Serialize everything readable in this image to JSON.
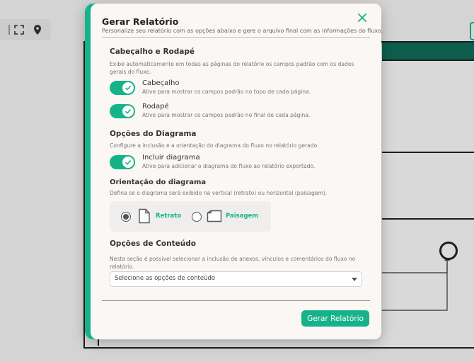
{
  "modal": {
    "title": "Gerar Relatório",
    "subtitle": "Personalize seu relatório com as opções abaixo e gere o arquivo final com as informações do fluxo."
  },
  "header_footer": {
    "title": "Cabeçalho e Rodapé",
    "description": "Exibe automaticamente em todas as páginas do relatório os campos padrão com os dados gerais do fluxo.",
    "header_label": "Cabeçalho",
    "header_hint": "Ative para mostrar os campos padrão no topo de cada página.",
    "header_on": true,
    "footer_label": "Rodapé",
    "footer_hint": "Ative para mostrar os campos padrão no final de cada página.",
    "footer_on": true
  },
  "diagram": {
    "title": "Opções do Diagrama",
    "description": "Configure a inclusão e a orientação do diagrama do fluxo no relatório gerado.",
    "include_label": "Incluir diagrama",
    "include_hint": "Ative para adicionar o diagrama do fluxo ao relatório exportado.",
    "include_on": true,
    "orientation_title": "Orientação do diagrama",
    "orientation_desc": "Defina se o diagrama será exibido na vertical (retrato) ou horizontal (paisagem).",
    "portrait_label": "Retrato",
    "landscape_label": "Paisagem",
    "selected": "Retrato"
  },
  "content": {
    "title": "Opções de Conteúdo",
    "description": "Nesta seção é possível selecionar a inclusão de anexos, vínculos e comentários do fluxo no relatório.",
    "select_placeholder": "Selecione as opções de conteúdo"
  },
  "actions": {
    "generate_label": "Gerar Relatório"
  },
  "colors": {
    "accent": "#16b38a",
    "header_bar": "#0f6b59"
  },
  "icons": [
    "close-icon",
    "check-icon",
    "portrait-page-icon",
    "landscape-page-icon",
    "chevron-down-icon",
    "fullscreen-icon",
    "location-pin-icon"
  ]
}
